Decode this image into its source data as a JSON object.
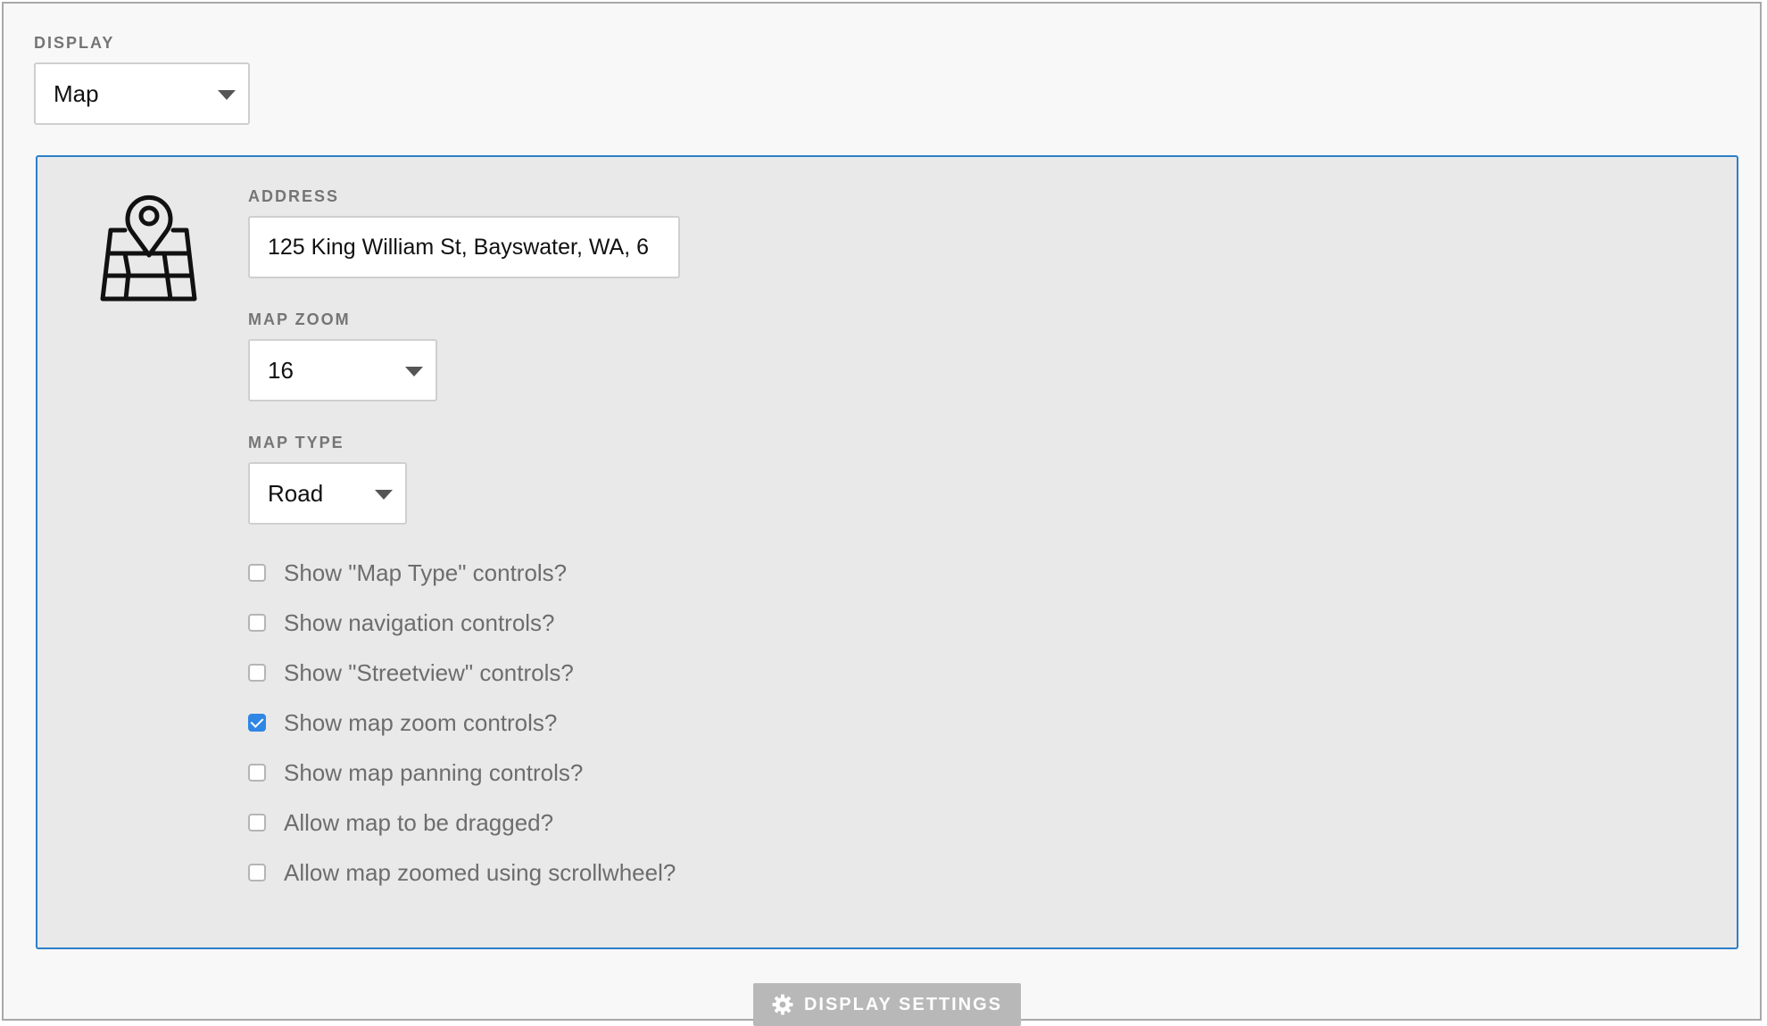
{
  "display": {
    "label": "DISPLAY",
    "selected": "Map"
  },
  "address": {
    "label": "ADDRESS",
    "value": "125 King William St, Bayswater, WA, 6"
  },
  "map_zoom": {
    "label": "MAP ZOOM",
    "selected": "16"
  },
  "map_type": {
    "label": "MAP TYPE",
    "selected": "Road"
  },
  "options": [
    {
      "label": "Show \"Map Type\" controls?",
      "checked": false
    },
    {
      "label": "Show navigation controls?",
      "checked": false
    },
    {
      "label": "Show \"Streetview\" controls?",
      "checked": false
    },
    {
      "label": "Show map zoom controls?",
      "checked": true
    },
    {
      "label": "Show map panning controls?",
      "checked": false
    },
    {
      "label": "Allow map to be dragged?",
      "checked": false
    },
    {
      "label": "Allow map zoomed using scrollwheel?",
      "checked": false
    }
  ],
  "footer": {
    "settings_label": "DISPLAY SETTINGS",
    "settings_icon": "gear-icon"
  },
  "colors": {
    "accent": "#2d7fc9",
    "checkbox_checked": "#2f86e5",
    "button_bg": "#b8b8b8"
  }
}
